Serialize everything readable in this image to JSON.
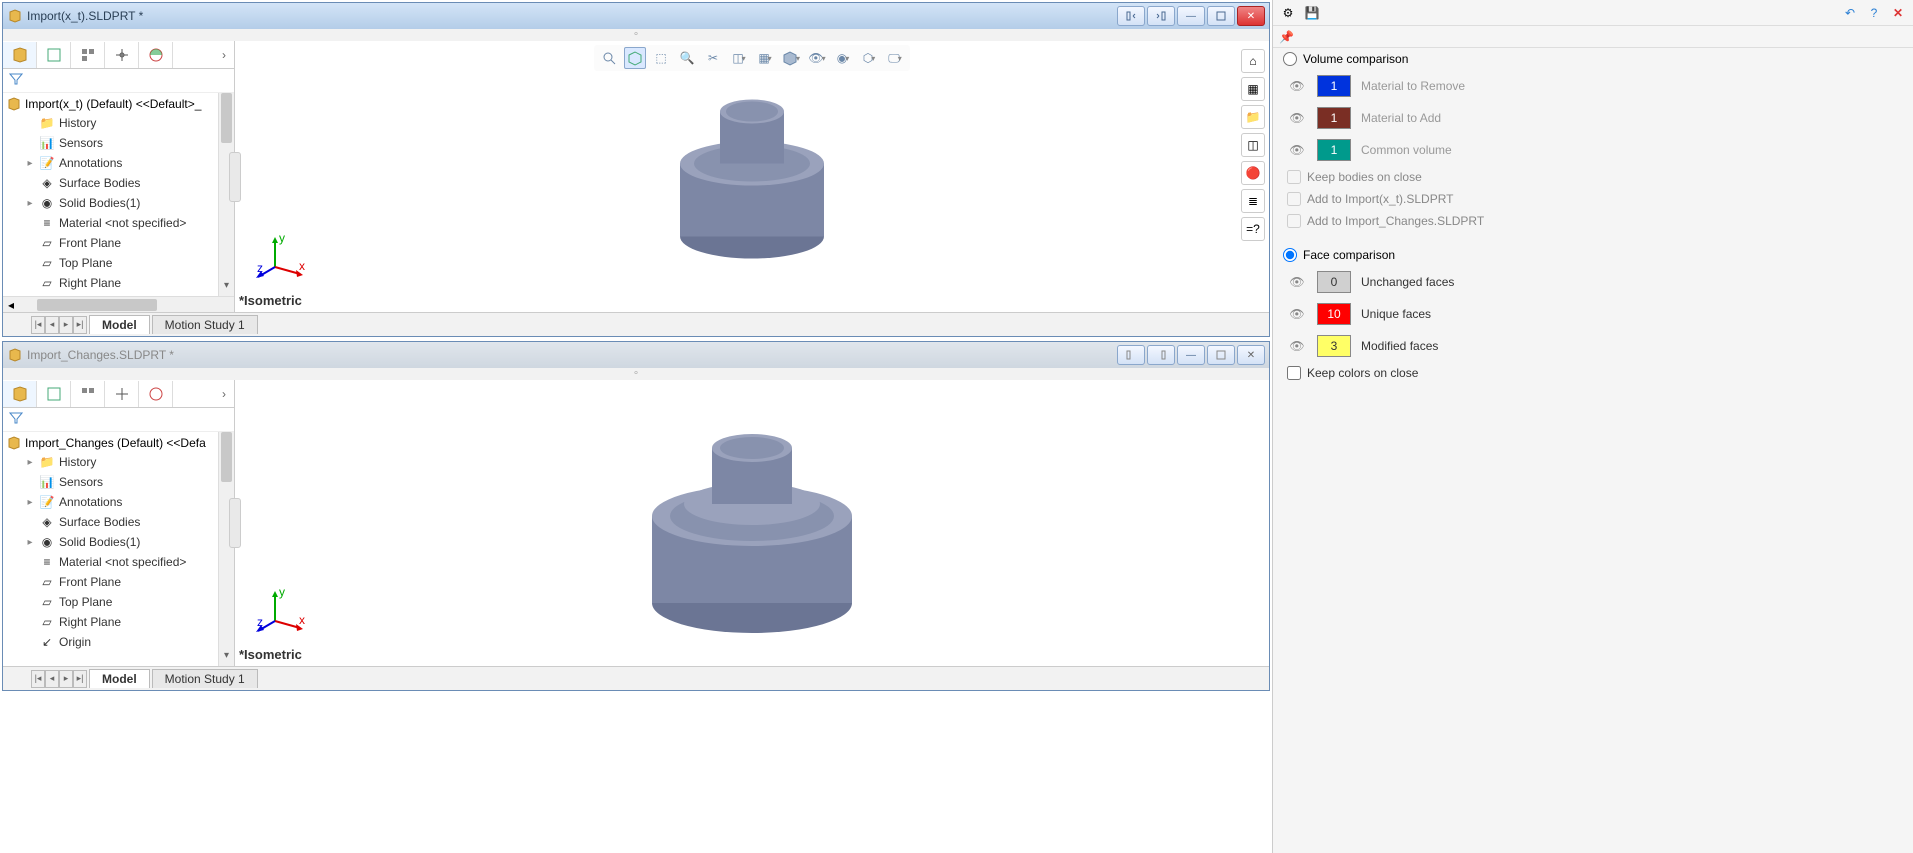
{
  "windows": {
    "top": {
      "title": "Import(x_t).SLDPRT *",
      "root": "Import(x_t) (Default) <<Default>_",
      "tree": [
        "History",
        "Sensors",
        "Annotations",
        "Surface Bodies",
        "Solid Bodies(1)",
        "Material <not specified>",
        "Front Plane",
        "Top Plane",
        "Right Plane"
      ],
      "view_label": "*Isometric"
    },
    "bottom": {
      "title": "Import_Changes.SLDPRT *",
      "root": "Import_Changes (Default) <<Defa",
      "tree": [
        "History",
        "Sensors",
        "Annotations",
        "Surface Bodies",
        "Solid Bodies(1)",
        "Material <not specified>",
        "Front Plane",
        "Top Plane",
        "Right Plane",
        "Origin"
      ],
      "view_label": "*Isometric"
    }
  },
  "bottom_tabs": {
    "model": "Model",
    "motion": "Motion Study 1"
  },
  "compare": {
    "volume_label": "Volume comparison",
    "volume_items": [
      {
        "count": "1",
        "label": "Material to Remove",
        "color": "blue"
      },
      {
        "count": "1",
        "label": "Material to Add",
        "color": "maroon"
      },
      {
        "count": "1",
        "label": "Common volume",
        "color": "teal"
      }
    ],
    "keep_bodies": "Keep bodies on close",
    "add_to_1": "Add to Import(x_t).SLDPRT",
    "add_to_2": "Add to Import_Changes.SLDPRT",
    "face_label": "Face comparison",
    "face_items": [
      {
        "count": "0",
        "label": "Unchanged faces",
        "color": "gray"
      },
      {
        "count": "10",
        "label": "Unique faces",
        "color": "red"
      },
      {
        "count": "3",
        "label": "Modified faces",
        "color": "yellow"
      }
    ],
    "keep_colors": "Keep colors on close"
  }
}
